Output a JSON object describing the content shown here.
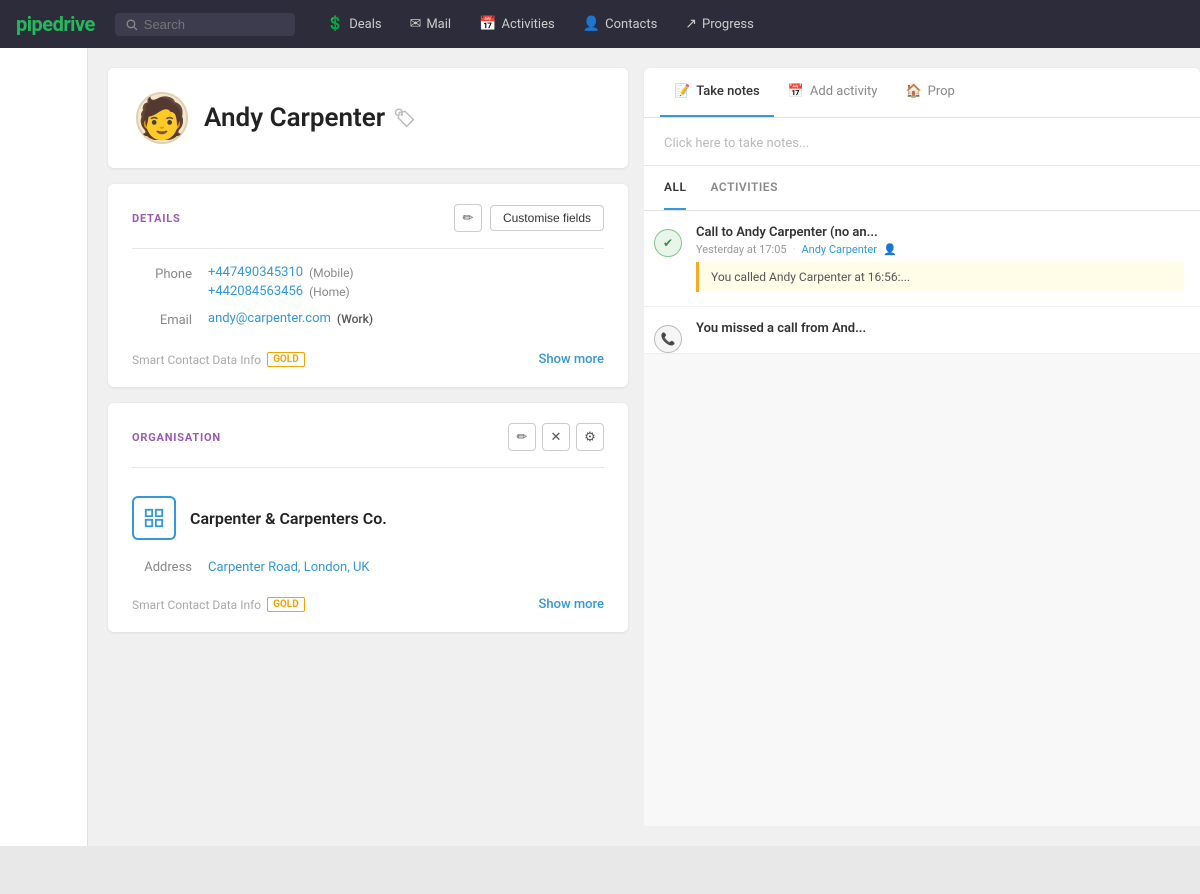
{
  "app": {
    "logo": "pipedrive"
  },
  "nav": {
    "search_placeholder": "Search",
    "items": [
      {
        "id": "deals",
        "label": "Deals",
        "icon": "💲"
      },
      {
        "id": "mail",
        "label": "Mail",
        "icon": "✉"
      },
      {
        "id": "activities",
        "label": "Activities",
        "icon": "📅"
      },
      {
        "id": "contacts",
        "label": "Contacts",
        "icon": "👤"
      },
      {
        "id": "progress",
        "label": "Progress",
        "icon": "↗"
      }
    ]
  },
  "contact": {
    "name": "Andy Carpenter",
    "avatar_emoji": "🧑"
  },
  "details": {
    "section_title": "DETAILS",
    "customise_btn": "Customise fields",
    "phone_label": "Phone",
    "phones": [
      {
        "number": "+447490345310",
        "type": "(Mobile)"
      },
      {
        "number": "+442084563456",
        "type": "(Home)"
      }
    ],
    "email_label": "Email",
    "emails": [
      {
        "address": "andy@carpenter.com",
        "type": "(Work)"
      }
    ],
    "smart_data_label": "Smart Contact Data Info",
    "gold_badge": "GOLD",
    "show_more": "Show more"
  },
  "organisation": {
    "section_title": "ORGANISATION",
    "name": "Carpenter & Carpenters Co.",
    "address_label": "Address",
    "address": "Carpenter Road, London, UK",
    "smart_data_label": "Smart Contact Data Info",
    "gold_badge": "GOLD",
    "show_more": "Show more"
  },
  "right_panel": {
    "tabs": [
      {
        "id": "take-notes",
        "label": "Take notes",
        "icon": "📝",
        "active": true
      },
      {
        "id": "add-activity",
        "label": "Add activity",
        "icon": "📅",
        "active": false
      },
      {
        "id": "prop",
        "label": "Prop",
        "icon": "🏠",
        "active": false
      }
    ],
    "notes_placeholder": "Click here to take notes...",
    "activity_tabs": [
      {
        "id": "all",
        "label": "ALL",
        "active": true
      },
      {
        "id": "activities",
        "label": "ACTIVITIES",
        "active": false
      }
    ],
    "activities": [
      {
        "id": 1,
        "type": "call_completed",
        "title": "Call to Andy Carpenter (no an...",
        "time": "Yesterday at 17:05",
        "person": "Andy Carpenter",
        "note": "You called Andy Carpenter at 16:56:..."
      },
      {
        "id": 2,
        "type": "call_missed",
        "title": "You missed a call from And...",
        "time": "",
        "person": "",
        "note": ""
      }
    ]
  }
}
